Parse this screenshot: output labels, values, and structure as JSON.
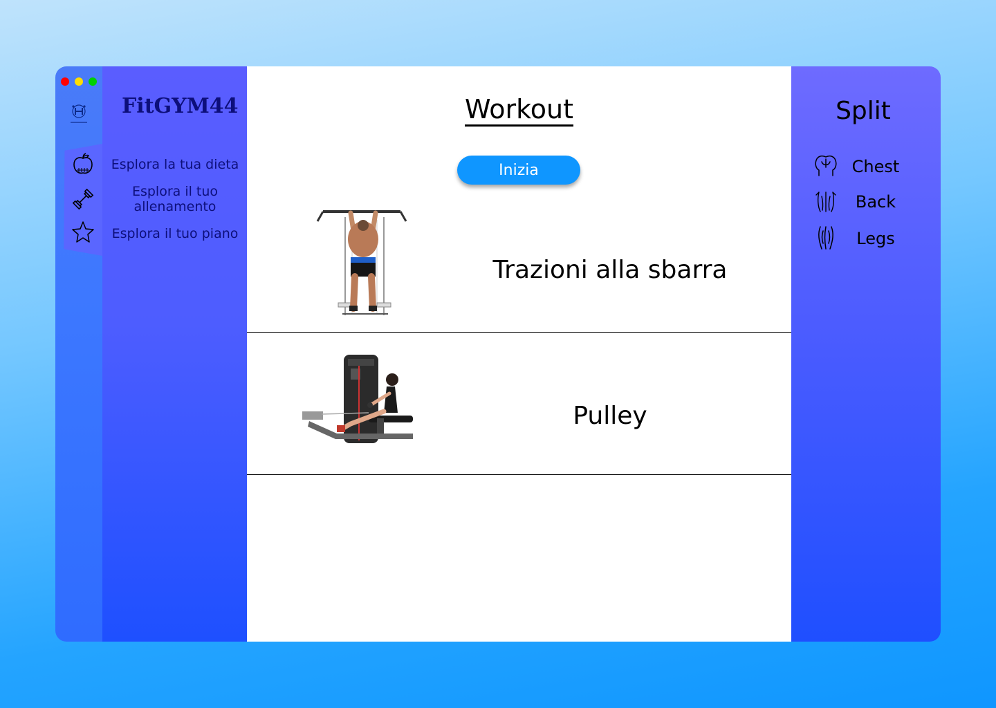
{
  "window_controls": {
    "close_color": "#ff0000",
    "minimize_color": "#ffdd00",
    "maximize_color": "#00d100"
  },
  "sidebar": {
    "brand": "FitGYM44",
    "items": [
      {
        "label": "Esplora la tua dieta",
        "icon": "apple-icon"
      },
      {
        "label": "Esplora il tuo allenamento",
        "icon": "dumbbell-icon"
      },
      {
        "label": "Esplora il tuo piano",
        "icon": "star-icon"
      }
    ]
  },
  "main": {
    "title": "Workout",
    "start_button": "Inizia",
    "exercises": [
      {
        "name": "Trazioni alla sbarra",
        "image": "pull-up-illustration"
      },
      {
        "name": "Pulley",
        "image": "seated-cable-row-illustration"
      }
    ]
  },
  "split": {
    "title": "Split",
    "items": [
      {
        "label": "Chest",
        "icon": "chest-icon"
      },
      {
        "label": "Back",
        "icon": "back-icon"
      },
      {
        "label": "Legs",
        "icon": "legs-icon"
      }
    ]
  },
  "colors": {
    "accent": "#0f96ff",
    "sidebar": "#4d5dff",
    "brand_text": "#0d0f7a"
  }
}
